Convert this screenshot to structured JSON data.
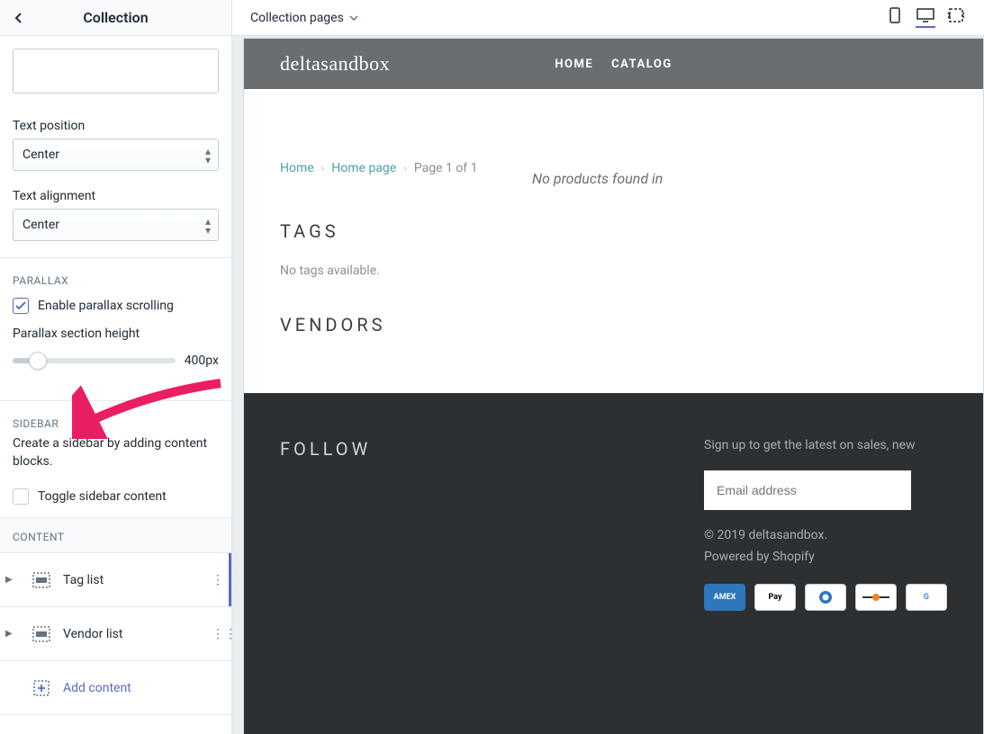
{
  "sidebar": {
    "title": "Collection",
    "fields": {
      "text_position_label": "Text position",
      "text_position_value": "Center",
      "text_alignment_label": "Text alignment",
      "text_alignment_value": "Center"
    },
    "parallax": {
      "section_title": "PARALLAX",
      "enable_label": "Enable parallax scrolling",
      "enable_checked": true,
      "height_label": "Parallax section height",
      "height_value": "400px"
    },
    "sidebar_section": {
      "section_title": "SIDEBAR",
      "description": "Create a sidebar by adding content blocks.",
      "toggle_label": "Toggle sidebar content",
      "toggle_checked": false
    },
    "content": {
      "section_title": "CONTENT",
      "items": [
        {
          "label": "Tag list"
        },
        {
          "label": "Vendor list"
        }
      ],
      "add_label": "Add content"
    }
  },
  "topbar": {
    "page_selector": "Collection pages"
  },
  "store": {
    "brand": "deltasandbox",
    "nav": {
      "home": "HOME",
      "catalog": "CATALOG"
    },
    "breadcrumb": {
      "home": "Home",
      "home_page": "Home page",
      "page_of": "Page 1 of 1"
    },
    "tags_heading": "TAGS",
    "no_tags": "No tags available.",
    "vendors_heading": "VENDORS",
    "no_products": "No products found in",
    "footer": {
      "follow_heading": "FOLLOW",
      "signup_text": "Sign up to get the latest on sales, new",
      "email_placeholder": "Email address",
      "copyright": "© 2019 deltasandbox.",
      "powered": "Powered by Shopify"
    }
  }
}
